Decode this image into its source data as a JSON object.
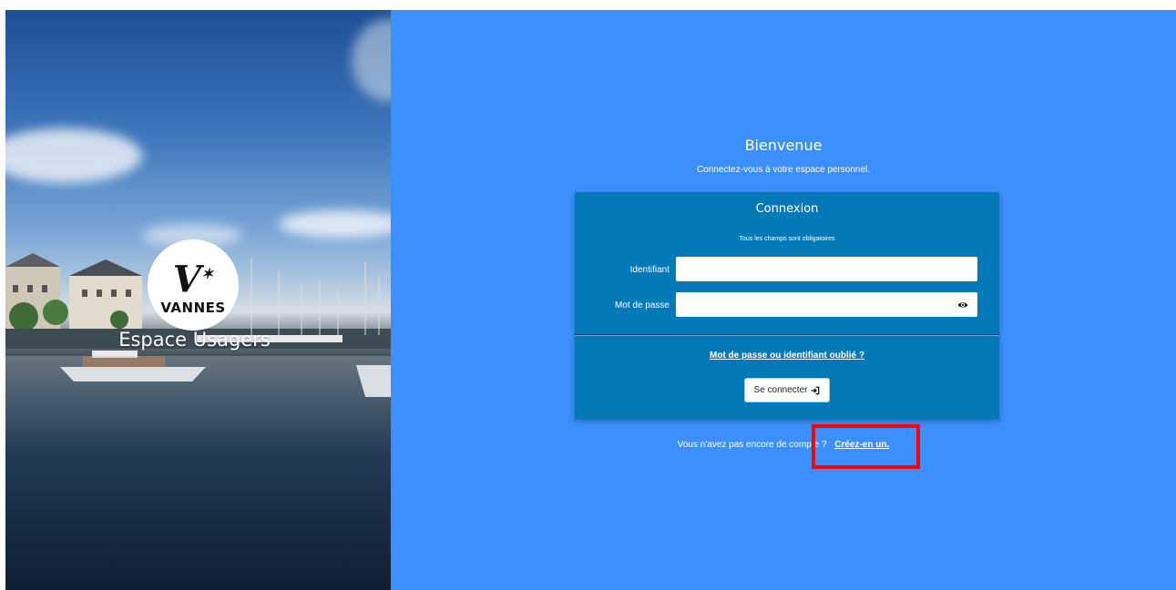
{
  "brand": {
    "logo_mark": "V",
    "logo_name": "VANNES",
    "caption": "Espace Usagers"
  },
  "login": {
    "welcome_title": "Bienvenue",
    "welcome_subtitle": "Connectez-vous à votre espace personnel.",
    "card_title": "Connexion",
    "required_note": "Tous les champs sont obligatoires",
    "fields": {
      "identifier_label": "Identifiant",
      "identifier_value": "",
      "password_label": "Mot de passe",
      "password_value": ""
    },
    "forgot_link": "Mot de passe ou identifiant oublié ?",
    "submit_label": "Se connecter"
  },
  "signup": {
    "prompt": "Vous n'avez pas encore de compte ?",
    "link": "Créez-en un."
  },
  "colors": {
    "panel_bg": "#3c8ffe",
    "card_bg": "#0379b7",
    "highlight": "#ff0000"
  }
}
